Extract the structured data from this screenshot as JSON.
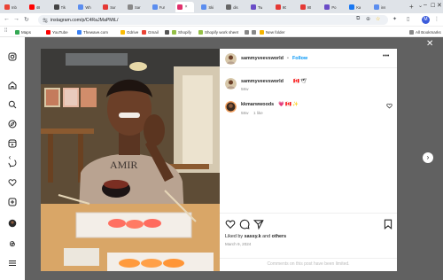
{
  "browser": {
    "tabs": [
      {
        "label": "Inb",
        "color": "#ea4335",
        "icon": "gmail-icon"
      },
      {
        "label": "48",
        "color": "#ff0000",
        "icon": "youtube-icon"
      },
      {
        "label": "Tik",
        "color": "#444444",
        "icon": "page-icon"
      },
      {
        "label": "Wh",
        "color": "#5b8def",
        "icon": "page-icon"
      },
      {
        "label": "Sur",
        "color": "#e53935",
        "icon": "page-icon"
      },
      {
        "label": "Sar",
        "color": "#888888",
        "icon": "google-icon"
      },
      {
        "label": "Fur",
        "color": "#5b8def",
        "icon": "page-icon"
      },
      {
        "label": "",
        "color": "#e1306c",
        "icon": "instagram-icon",
        "active": true
      },
      {
        "label": "Ski",
        "color": "#5b8def",
        "icon": "page-icon"
      },
      {
        "label": "dis",
        "color": "#666666",
        "icon": "page-icon"
      },
      {
        "label": "Tw",
        "color": "#6a4cc7",
        "icon": "page-icon"
      },
      {
        "label": "90",
        "color": "#e53935",
        "icon": "page-icon"
      },
      {
        "label": "90",
        "color": "#e53935",
        "icon": "page-icon"
      },
      {
        "label": "Po",
        "color": "#6a4cc7",
        "icon": "page-icon"
      },
      {
        "label": "Ka",
        "color": "#1877f2",
        "icon": "facebook-icon"
      },
      {
        "label": "ins",
        "color": "#5b8def",
        "icon": "page-icon"
      }
    ],
    "url": "instagram.com/p/C4RaJMaPMtL/",
    "profile_initial": "M",
    "bookmarks": [
      {
        "label": "Maps",
        "color": "#34a853"
      },
      {
        "label": "YouTube",
        "color": "#ff0000"
      },
      {
        "label": "Thewave.com",
        "color": "#3b82f6"
      },
      {
        "label": "Gdrive",
        "color": "#fbbc05"
      },
      {
        "label": "Gmail",
        "color": "#ea4335"
      },
      {
        "label": "",
        "color": "#555555"
      },
      {
        "label": "Shopify",
        "color": "#95bf47"
      },
      {
        "label": "Shopify work sheet",
        "color": "#95bf47"
      },
      {
        "label": "",
        "color": "#888888"
      },
      {
        "label": "",
        "color": "#888888"
      },
      {
        "label": "New folder",
        "color": "#f4b400"
      }
    ],
    "all_bookmarks_label": "All Bookmarks"
  },
  "post": {
    "author": "sammyveevsworld",
    "follow_label": "Follow",
    "separator": "•",
    "caption_author": "sammyveevsworld",
    "caption_text": "🇨🇦 🕊",
    "caption_time": "58w",
    "comment": {
      "author": "kkmarwwoods",
      "text": "💗 🇨🇦 ✨",
      "time": "58w",
      "likes": "1 like"
    },
    "liked_by_prefix": "Liked by",
    "liked_by_user": "sassy.k",
    "liked_by_and": "and",
    "liked_by_others": "others",
    "date": "March 9, 2024",
    "comments_closed": "Comments on this post have been limited."
  }
}
